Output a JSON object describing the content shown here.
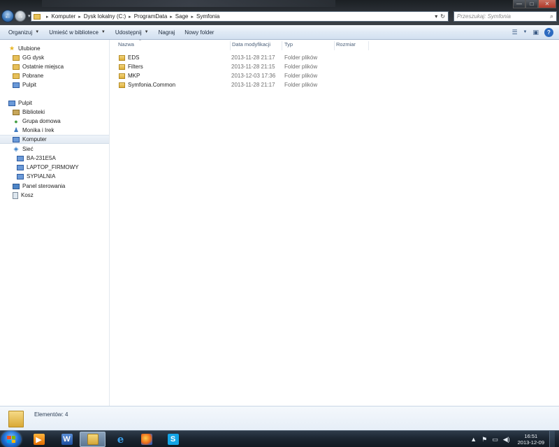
{
  "window": {
    "minimize_glyph": "—",
    "maximize_glyph": "□",
    "close_glyph": "✕"
  },
  "address": {
    "breadcrumb": [
      "Komputer",
      "Dysk lokalny (C:)",
      "ProgramData",
      "Sage",
      "Symfonia"
    ],
    "separator": "▸",
    "refresh_glyph": "↻",
    "dropdown_glyph": "▾"
  },
  "search": {
    "placeholder": "Przeszukaj: Symfonia"
  },
  "toolbar": {
    "organize": "Organizuj",
    "include_in_library": "Umieść w bibliotece",
    "share": "Udostępnij",
    "burn": "Nagraj",
    "new_folder": "Nowy folder",
    "help": "?"
  },
  "sidebar": {
    "favorites": {
      "label": "Ulubione",
      "items": [
        "GG dysk",
        "Ostatnie miejsca",
        "Pobrane",
        "Pulpit"
      ]
    },
    "desktop": {
      "label": "Pulpit",
      "items": [
        "Biblioteki",
        "Grupa domowa",
        "Monika i Irek",
        "Komputer",
        "Sieć"
      ]
    },
    "network_items": [
      "BA-231E5A",
      "LAPTOP_FIRMOWY",
      "SYPIALNIA"
    ],
    "bottom_items": [
      "Panel sterowania",
      "Kosz"
    ],
    "selected": "Komputer"
  },
  "columns": {
    "name": "Nazwa",
    "modified": "Data modyfikacji",
    "type": "Typ",
    "size": "Rozmiar"
  },
  "files": [
    {
      "name": "EDS",
      "modified": "2013-11-28 21:17",
      "type": "Folder plików"
    },
    {
      "name": "Filters",
      "modified": "2013-11-28 21:15",
      "type": "Folder plików"
    },
    {
      "name": "MKP",
      "modified": "2013-12-03 17:36",
      "type": "Folder plików"
    },
    {
      "name": "Symfonia.Common",
      "modified": "2013-11-28 21:17",
      "type": "Folder plików"
    }
  ],
  "status": {
    "count": "Elementów: 4"
  },
  "taskbar": {
    "apps": [
      "media-player",
      "word",
      "explorer",
      "internet-explorer",
      "firefox",
      "skype"
    ],
    "ie_glyph": "e",
    "word_glyph": "W",
    "skype_glyph": "S",
    "active": "explorer",
    "time": "16:51",
    "date": "2013-12-09",
    "tray_glyphs": [
      "▲",
      "⚑",
      "▭",
      "◀)"
    ]
  }
}
